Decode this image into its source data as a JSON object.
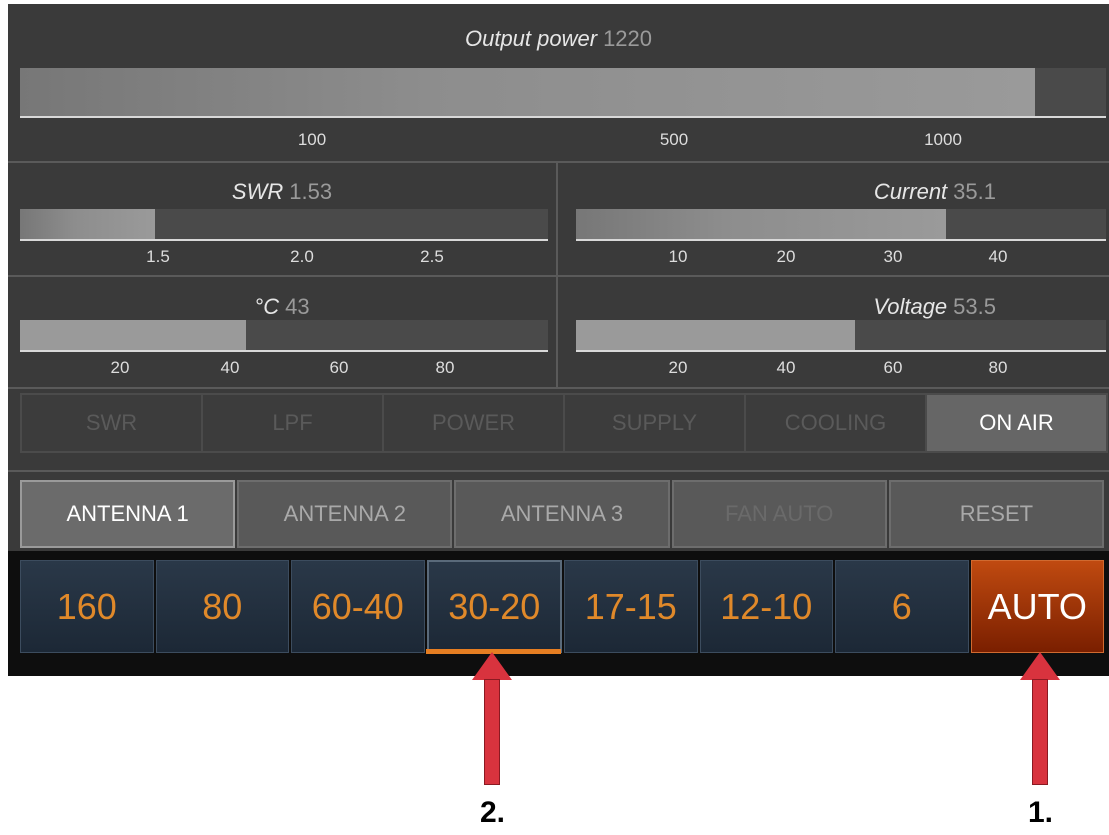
{
  "output_power": {
    "label": "Output power",
    "value": "1220",
    "level": 1220,
    "scale": [
      "100",
      "500",
      "1000"
    ]
  },
  "swr": {
    "label": "SWR",
    "value": "1.53",
    "level": 1.53,
    "scale": [
      "1.5",
      "2.0",
      "2.5"
    ]
  },
  "current": {
    "label": "Current",
    "value": "35.1",
    "level": 35.1,
    "scale": [
      "10",
      "20",
      "30",
      "40"
    ]
  },
  "temperature": {
    "label": "°C",
    "value": "43",
    "level": 43,
    "scale": [
      "20",
      "40",
      "60",
      "80"
    ]
  },
  "voltage": {
    "label": "Voltage",
    "value": "53.5",
    "level": 53.5,
    "scale": [
      "20",
      "40",
      "60",
      "80"
    ]
  },
  "status": [
    {
      "label": "SWR",
      "active": false
    },
    {
      "label": "LPF",
      "active": false
    },
    {
      "label": "POWER",
      "active": false
    },
    {
      "label": "SUPPLY",
      "active": false
    },
    {
      "label": "COOLING",
      "active": false
    },
    {
      "label": "ON AIR",
      "active": true
    }
  ],
  "controls": [
    {
      "label": "ANTENNA 1",
      "state": "selected"
    },
    {
      "label": "ANTENNA 2",
      "state": "normal"
    },
    {
      "label": "ANTENNA 3",
      "state": "normal"
    },
    {
      "label": "FAN AUTO",
      "state": "disabled"
    },
    {
      "label": "RESET",
      "state": "normal"
    }
  ],
  "bands": [
    {
      "label": "160"
    },
    {
      "label": "80"
    },
    {
      "label": "60-40"
    },
    {
      "label": "30-20",
      "selected": true
    },
    {
      "label": "17-15"
    },
    {
      "label": "12-10"
    },
    {
      "label": "6"
    },
    {
      "label": "AUTO",
      "active": true
    }
  ],
  "callouts": [
    "2.",
    "1."
  ],
  "colors": {
    "accent": "#e67e22",
    "auto": "#c04a10",
    "arrow": "#d8333e"
  }
}
